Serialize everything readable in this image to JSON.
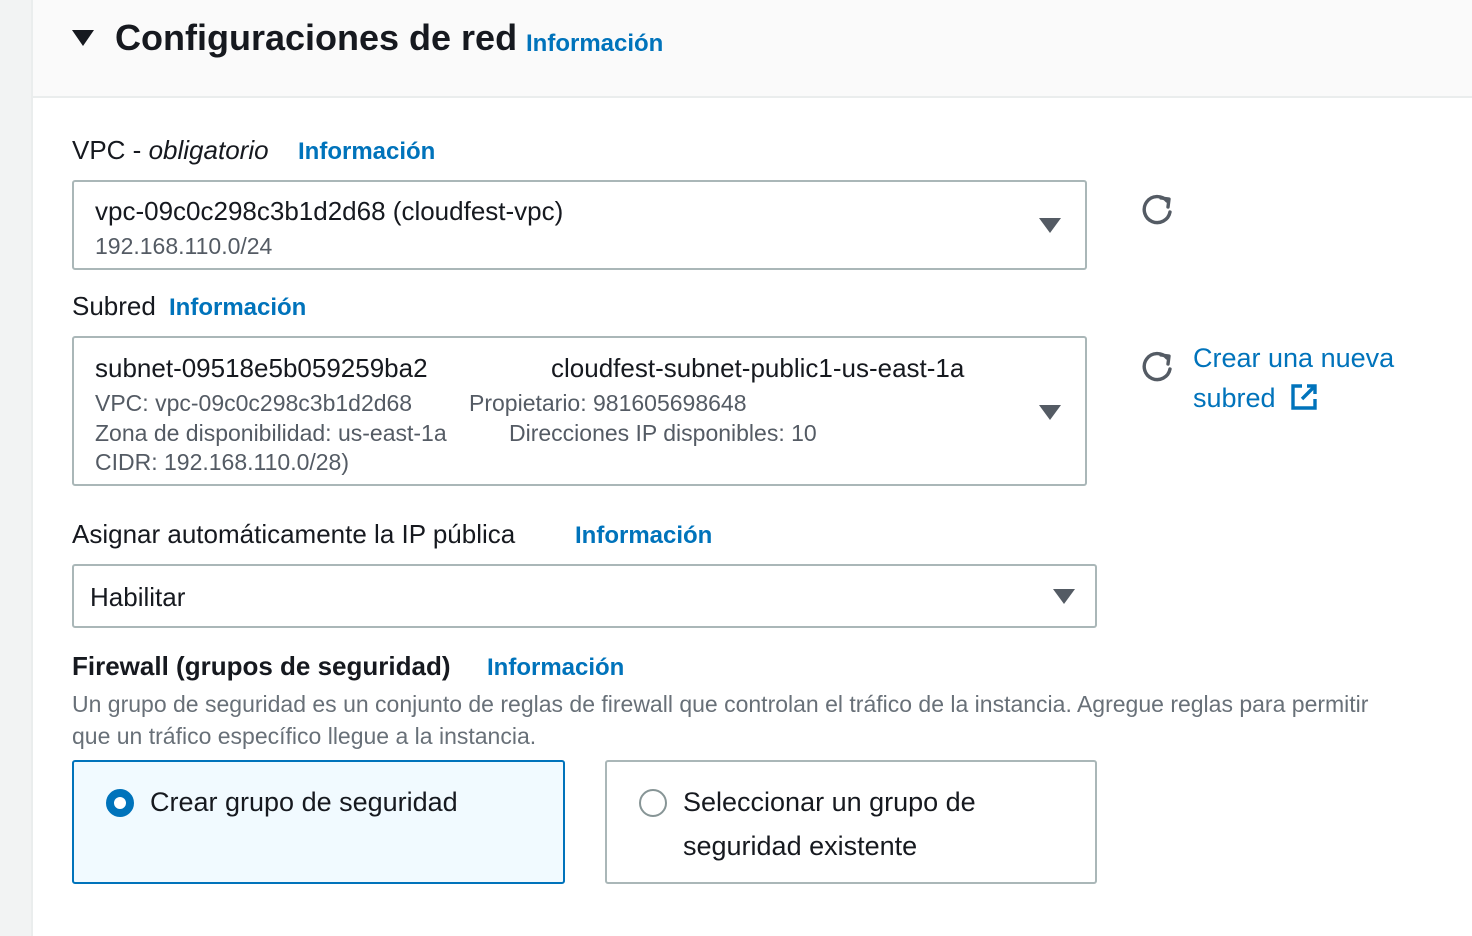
{
  "section": {
    "title": "Configuraciones de red",
    "info_label": "Información"
  },
  "vpc": {
    "label_main": "VPC - ",
    "label_required": "obligatorio",
    "info_label": "Información",
    "selected_value": "vpc-09c0c298c3b1d2d68 (cloudfest-vpc)",
    "selected_cidr": "192.168.110.0/24",
    "refresh_icon": "refresh-icon"
  },
  "subnet": {
    "label": "Subred",
    "info_label": "Información",
    "selected_id": "subnet-09518e5b059259ba2",
    "selected_name": "cloudfest-subnet-public1-us-east-1a",
    "vpc_detail": "VPC: vpc-09c0c298c3b1d2d68",
    "owner_detail": "Propietario: 981605698648",
    "az_detail": "Zona de disponibilidad: us-east-1a",
    "ips_detail": "Direcciones IP disponibles: 10",
    "cidr_detail": "CIDR: 192.168.110.0/28)",
    "create_link_line1": "Crear una nueva",
    "create_link_line2": "subred",
    "refresh_icon": "refresh-icon",
    "external_icon": "external-link-icon"
  },
  "public_ip": {
    "label": "Asignar automáticamente la IP pública",
    "info_label": "Información",
    "selected_value": "Habilitar"
  },
  "firewall": {
    "label": "Firewall (grupos de seguridad)",
    "info_label": "Información",
    "description": "Un grupo de seguridad es un conjunto de reglas de firewall que controlan el tráfico de la instancia. Agregue reglas para permitir que un tráfico específico llegue a la instancia.",
    "option_create": "Crear grupo de seguridad",
    "option_select_line1": "Seleccionar un grupo de",
    "option_select_line2": "seguridad existente",
    "selected_option": "create"
  },
  "colors": {
    "link": "#0073bb",
    "border": "#aab7b8",
    "selected_tile_bg": "#f1faff"
  }
}
